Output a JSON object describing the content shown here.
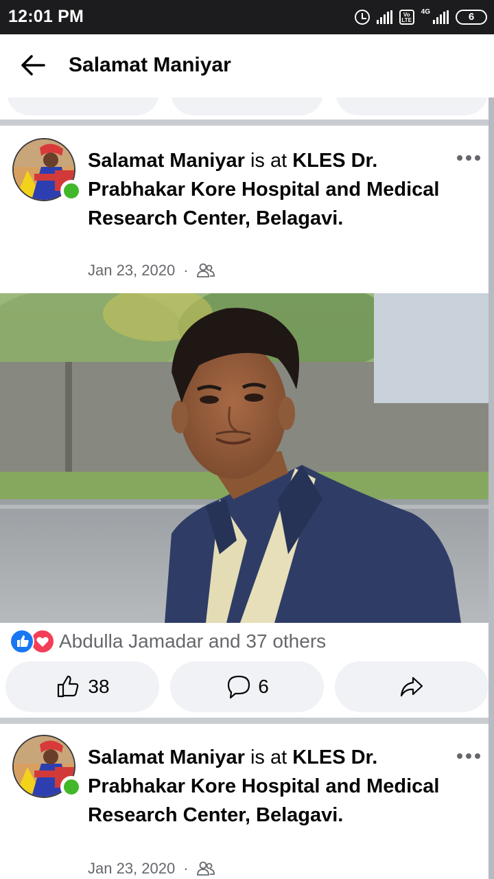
{
  "status_bar": {
    "time": "12:01 PM",
    "network": "4G",
    "volte": "Vo LTE",
    "battery": "6"
  },
  "header": {
    "title": "Salamat Maniyar",
    "back_icon": "arrow-left-icon"
  },
  "posts": [
    {
      "author": "Salamat Maniyar",
      "connector": " is at ",
      "place": "KLES Dr. Prabhakar Kore Hospital and Medical Research Center, Belagavi.",
      "date": "Jan 23, 2020",
      "separator": "·",
      "privacy_icon": "friends-icon",
      "reactions_text": "Abdulla Jamadar and 37 others",
      "like_count": "38",
      "comment_count": "6"
    },
    {
      "author": "Salamat Maniyar",
      "connector": " is at ",
      "place": "KLES Dr. Prabhakar Kore Hospital and Medical Research Center, Belagavi.",
      "date": "Jan 23, 2020",
      "separator": "·",
      "privacy_icon": "friends-icon"
    }
  ],
  "colors": {
    "accent": "#1877f2",
    "love": "#f33e58",
    "online": "#42b72a",
    "pill": "#f0f2f5",
    "muted": "#65676b"
  }
}
